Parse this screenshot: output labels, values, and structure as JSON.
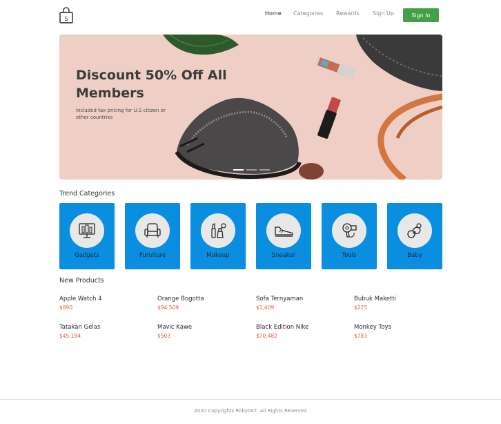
{
  "header": {
    "logo_letter": "S",
    "nav": [
      "Home",
      "Categories",
      "Rewards",
      "Sign Up"
    ],
    "signin_label": "Sign In"
  },
  "hero": {
    "title": "Discount 50% Off All Members",
    "subtitle": "Included tax pricing for U.S citizen or other countries",
    "background": "#efcfc5",
    "active_slide": 1,
    "slide_count": 3
  },
  "categories": {
    "title": "Trend Categories",
    "color": "#0a8ee0",
    "items": [
      {
        "label": "Gadgets",
        "icon": "gadgets-icon"
      },
      {
        "label": "Furniture",
        "icon": "armchair-icon"
      },
      {
        "label": "Makeup",
        "icon": "makeup-icon"
      },
      {
        "label": "Sneaker",
        "icon": "sneaker-icon"
      },
      {
        "label": "Tools",
        "icon": "hair-dryer-icon"
      },
      {
        "label": "Baby",
        "icon": "pacifier-icon"
      }
    ]
  },
  "products": {
    "title": "New Products",
    "price_color": "#e0603a",
    "items": [
      {
        "name": "Apple Watch 4",
        "price": "$890"
      },
      {
        "name": "Orange Bogotta",
        "price": "$94,509"
      },
      {
        "name": "Sofa Ternyaman",
        "price": "$1,409"
      },
      {
        "name": "Bubuk Maketti",
        "price": "$225"
      },
      {
        "name": "Tatakan Gelas",
        "price": "$45,184"
      },
      {
        "name": "Mavic Kawe",
        "price": "$503"
      },
      {
        "name": "Black Edition Nike",
        "price": "$70,482"
      },
      {
        "name": "Monkey Toys",
        "price": "$783"
      }
    ]
  },
  "footer": {
    "text": "2020 Copyrights Roby047. All Rights Reserved"
  },
  "colors": {
    "accent_green": "#43a047",
    "category_blue": "#0a8ee0"
  }
}
